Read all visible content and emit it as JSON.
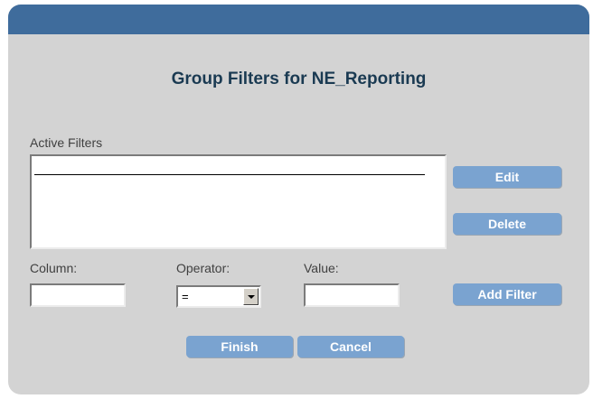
{
  "dialog": {
    "heading": "Group Filters for NE_Reporting"
  },
  "active_filters": {
    "label": "Active Filters",
    "items": []
  },
  "actions": {
    "edit_label": "Edit",
    "delete_label": "Delete",
    "add_filter_label": "Add Filter",
    "finish_label": "Finish",
    "cancel_label": "Cancel"
  },
  "filter_form": {
    "column_label": "Column:",
    "column_value": "",
    "operator_label": "Operator:",
    "operator_value": "=",
    "value_label": "Value:",
    "value_value": ""
  },
  "colors": {
    "title_bar": "#3f6c9c",
    "dialog_bg": "#d3d3d3",
    "button_bg": "#7aa3d0",
    "heading_text": "#1a3a52"
  },
  "icons": {
    "operator_dropdown": "chevron-down-icon"
  }
}
